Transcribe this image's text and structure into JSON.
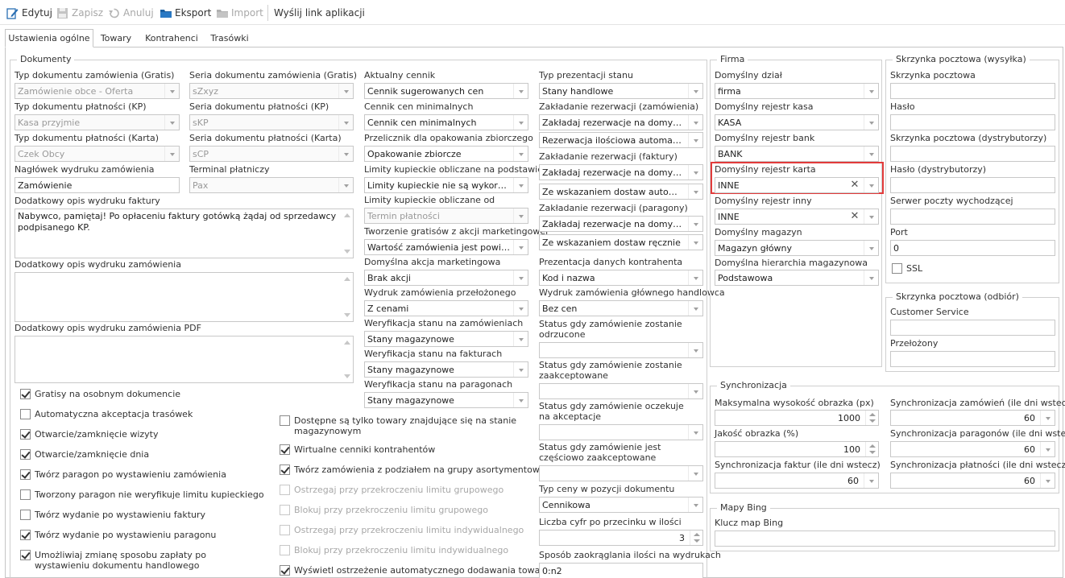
{
  "toolbar": {
    "edit": "Edytuj",
    "save": "Zapisz",
    "cancel": "Anuluj",
    "export": "Eksport",
    "import": "Import",
    "send_link": "Wyślij link aplikacji"
  },
  "tabs": [
    "Ustawienia ogólne",
    "Towary",
    "Kontrahenci",
    "Trasówki"
  ],
  "dokumenty": {
    "title": "Dokumenty",
    "col1": [
      {
        "label": "Typ dokumentu zamówienia (Gratis)",
        "value": "Zamówienie obce - Oferta"
      },
      {
        "label": "Typ dokumentu płatności (KP)",
        "value": "Kasa przyjmie"
      },
      {
        "label": "Typ dokumentu płatności (Karta)",
        "value": "Czek Obcy"
      },
      {
        "label": "Nagłówek wydruku zamówienia",
        "value": "Zamówienie"
      }
    ],
    "col2": [
      {
        "label": "Seria dokumentu zamówienia (Gratis)",
        "value": "sZxyz"
      },
      {
        "label": "Seria dokumentu płatności (KP)",
        "value": "sKP"
      },
      {
        "label": "Seria dokumentu płatności (Karta)",
        "value": "sCP"
      },
      {
        "label": "Terminal płatniczy",
        "value": "Pax"
      }
    ],
    "invoice_desc_label": "Dodatkowy opis wydruku faktury",
    "invoice_desc_value": "Nabywco, pamiętaj! Po opłaceniu faktury gotówką żądaj od sprzedawcy podpisanego KP.",
    "order_desc_label": "Dodatkowy opis wydruku zamówienia",
    "pdf_desc_label": "Dodatkowy opis wydruku zamówienia PDF",
    "checks_left": [
      {
        "label": "Gratisy na osobnym dokumencie",
        "checked": true
      },
      {
        "label": "Automatyczna akceptacja trasówek",
        "checked": false
      },
      {
        "label": "Otwarcie/zamknięcie wizyty",
        "checked": true
      },
      {
        "label": "Otwarcie/zamknięcie dnia",
        "checked": true
      },
      {
        "label": "Twórz paragon po wystawieniu zamówienia",
        "checked": true
      },
      {
        "label": "Tworzony paragon nie weryfikuje limitu kupieckiego",
        "checked": false
      },
      {
        "label": "Twórz wydanie po wystawieniu faktury",
        "checked": false
      },
      {
        "label": "Twórz wydanie po wystawieniu paragonu",
        "checked": true
      },
      {
        "label": "Umożliwiaj zmianę sposobu zapłaty po wystawieniu dokumentu handlowego",
        "checked": true
      }
    ],
    "checks_mid": [
      {
        "label": "Dostępne są tylko towary znajdujące się na stanie magazynowym",
        "checked": false,
        "disabled": false
      },
      {
        "label": "Wirtualne cenniki kontrahentów",
        "checked": true,
        "disabled": false
      },
      {
        "label": "Twórz zamówienia z podziałem na grupy asortymentowe",
        "checked": true,
        "disabled": false
      },
      {
        "label": "Ostrzegaj przy przekroczeniu limitu grupowego",
        "checked": false,
        "disabled": true
      },
      {
        "label": "Blokuj przy przekroczeniu limitu grupowego",
        "checked": false,
        "disabled": true
      },
      {
        "label": "Ostrzegaj przy przekroczeniu limitu indywidualnego",
        "checked": false,
        "disabled": true
      },
      {
        "label": "Blokuj przy przekroczeniu limitu indywidualnego",
        "checked": false,
        "disabled": true
      },
      {
        "label": "Wyświetl ostrzeżenie automatycznego dodawania towarów",
        "checked": true,
        "disabled": false
      }
    ],
    "col3": [
      {
        "label": "Aktualny cennik",
        "value": "Cennik sugerowanych cen"
      },
      {
        "label": "Cennik cen minimalnych",
        "value": "Cennik cen minimalnych"
      },
      {
        "label": "Przelicznik dla opakowania zbiorczego",
        "value": "Opakowanie zbiorcze"
      },
      {
        "label": "Limity kupieckie obliczane na podstawie",
        "value": "Limity kupieckie nie są wykorzystywane"
      },
      {
        "label": "Limity kupieckie obliczane od",
        "value": "Termin płatności"
      },
      {
        "label": "Tworzenie gratisów z akcji marketingowej",
        "value": "Wartość zamówienia jest powiększana"
      },
      {
        "label": "Domyślna akcja marketingowa",
        "value": "Brak akcji"
      },
      {
        "label": "Wydruk zamówienia przełożonego",
        "value": "Z cenami"
      },
      {
        "label": "Weryfikacja stanu na zamówieniach",
        "value": "Stany magazynowe"
      },
      {
        "label": "Weryfikacja stanu na fakturach",
        "value": "Stany magazynowe"
      },
      {
        "label": "Weryfikacja stanu na paragonach",
        "value": "Stany magazynowe"
      }
    ],
    "col4": {
      "presentation_label": "Typ prezentacji stanu",
      "presentation_value": "Stany handlowe",
      "res_order_label": "Zakładanie rezerwacji (zamówienia)",
      "res_order_value1": "Zakładaj rezerwacje na domyślnym magazynie",
      "res_order_value2": "Rezerwacja ilościowa automatyczna",
      "res_invoice_label": "Zakładanie rezerwacji (faktury)",
      "res_invoice_value1": "Zakładaj rezerwacje na domyślnym magazynie",
      "res_invoice_value2": "Ze wskazaniem dostaw automatycznie",
      "res_receipt_label": "Zakładanie rezerwacji (paragony)",
      "res_receipt_value1": "Zakładaj rezerwacje na domyślnym magazynie",
      "res_receipt_value2": "Ze wskazaniem dostaw ręcznie",
      "contractor_label": "Prezentacja danych kontrahenta",
      "contractor_value": "Kod i nazwa",
      "main_order_label": "Wydruk zamówienia głównego handlowca",
      "main_order_value": "Bez cen",
      "status_rejected_label": "Status gdy zamówienie zostanie odrzucone",
      "status_accepted_label": "Status gdy zamówienie zostanie zaakceptowane",
      "status_waiting_label": "Status gdy zamówienie oczekuje na akceptacje",
      "status_partial_label": "Status gdy zamówienie jest częściowo zaakceptowane",
      "price_type_label": "Typ ceny w pozycji dokumentu",
      "price_type_value": "Cennikowa",
      "decimals_label": "Liczba cyfr po przecinku w ilości",
      "decimals_value": "3",
      "rounding_label": "Sposób zaokrąglania ilości na wydrukach",
      "rounding_value": "0:n2"
    }
  },
  "firma": {
    "title": "Firma",
    "fields": [
      {
        "label": "Domyślny dział",
        "value": "firma",
        "clear": false,
        "highlight": false
      },
      {
        "label": "Domyślny rejestr kasa",
        "value": "KASA",
        "clear": false,
        "highlight": false
      },
      {
        "label": "Domyślny rejestr bank",
        "value": "BANK",
        "clear": false,
        "highlight": false
      },
      {
        "label": "Domyślny rejestr karta",
        "value": "INNE",
        "clear": true,
        "highlight": true
      },
      {
        "label": "Domyślny rejestr inny",
        "value": "INNE",
        "clear": true,
        "highlight": false
      },
      {
        "label": "Domyślny magazyn",
        "value": "Magazyn główny",
        "clear": false,
        "highlight": false
      },
      {
        "label": "Domyślna hierarchia magazynowa",
        "value": "Podstawowa",
        "clear": false,
        "highlight": false
      }
    ]
  },
  "mail_out": {
    "title": "Skrzynka pocztowa (wysyłka)",
    "mailbox_label": "Skrzynka pocztowa",
    "password_label": "Hasło",
    "mailbox_dist_label": "Skrzynka pocztowa (dystrybutorzy)",
    "password_dist_label": "Hasło (dystrybutorzy)",
    "smtp_label": "Serwer poczty wychodzącej",
    "port_label": "Port",
    "port_value": "0",
    "ssl_label": "SSL"
  },
  "mail_in": {
    "title": "Skrzynka pocztowa (odbiór)",
    "customer_service_label": "Customer Service",
    "supervisor_label": "Przełożony"
  },
  "sync": {
    "title": "Synchronizacja",
    "max_image_label": "Maksymalna wysokość obrazka (px)",
    "max_image_value": "1000",
    "quality_label": "Jakość obrazka (%)",
    "quality_value": "100",
    "invoices_label": "Synchronizacja faktur (ile dni wstecz)",
    "invoices_value": "60",
    "orders_label": "Synchronizacja zamówień (ile dni wstecz)",
    "orders_value": "60",
    "receipts_label": "Synchronizacja paragonów (ile dni wstecz)",
    "receipts_value": "60",
    "payments_label": "Synchronizacja płatności (ile dni wstecz)",
    "payments_value": "60"
  },
  "bing": {
    "title": "Mapy Bing",
    "key_label": "Klucz map Bing"
  }
}
